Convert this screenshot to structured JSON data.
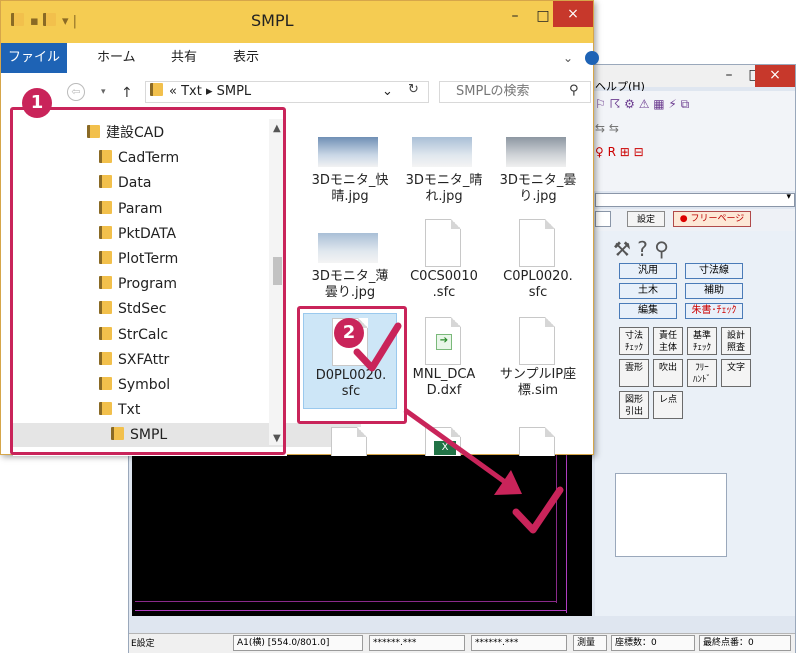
{
  "cad": {
    "menu_help": "ヘルプ(H)",
    "min_glyph": "–",
    "max_glyph": "□",
    "close_glyph": "×",
    "toolbar_row1": "⚐ ☈ ⚙ ⚠ ▦ ⚡ ⧉",
    "toolbar_row2": "⇆ ⇆",
    "toolbar_row3": "♀ R ⊞ ⊟",
    "btn_settei": "設定",
    "btn_freepage": "フリーページ",
    "palette": {
      "hanyou": "汎用",
      "sunposen": "寸法線",
      "doboku": "土木",
      "hojo": "補助",
      "henshu": "編集",
      "shusho_check": "朱書･ﾁｪｯｸ",
      "squares_row1": [
        "寸法\nﾁｪｯｸ",
        "責任\n主体",
        "基準\nﾁｪｯｸ",
        "設計\n照査"
      ],
      "squares_row2": [
        "雲形",
        "吹出",
        "ﾌﾘｰ\nﾊﾝﾄﾞ",
        "文字"
      ],
      "squares_row3": [
        "図形\n引出",
        "レ点"
      ]
    },
    "status": {
      "settings": "E設定",
      "paper": "A1(横) [554.0/801.0]",
      "coord_x": "******.***",
      "coord_y": "******.***",
      "survey": "測量",
      "coord_count": "座標数：0",
      "last_point": "最終点番：0"
    }
  },
  "explorer": {
    "title": "SMPL",
    "min_glyph": "–",
    "max_glyph": "□",
    "close_glyph": "×",
    "ribbon_tabs": [
      "ファイル",
      "ホーム",
      "共有",
      "表示"
    ],
    "ribbon_chevron": "⌄",
    "address": {
      "back": "⇦",
      "fwd": "▾",
      "up": "↑",
      "path": "« Txt ▸ SMPL",
      "dropdown": "⌄",
      "refresh": "↻"
    },
    "search_placeholder": "SMPLの検索",
    "search_glyph": "⚲",
    "nav_items": [
      {
        "label": "建設CAD",
        "indent": 0
      },
      {
        "label": "CadTerm",
        "indent": 1
      },
      {
        "label": "Data",
        "indent": 1
      },
      {
        "label": "Param",
        "indent": 1
      },
      {
        "label": "PktDATA",
        "indent": 1
      },
      {
        "label": "PlotTerm",
        "indent": 1
      },
      {
        "label": "Program",
        "indent": 1
      },
      {
        "label": "StdSec",
        "indent": 1
      },
      {
        "label": "StrCalc",
        "indent": 1
      },
      {
        "label": "SXFAttr",
        "indent": 1
      },
      {
        "label": "Symbol",
        "indent": 1
      },
      {
        "label": "Txt",
        "indent": 1
      },
      {
        "label": "SMPL",
        "indent": 2,
        "selected": true
      }
    ],
    "files": [
      {
        "name": "3Dモニタ_快\n晴.jpg",
        "kind": "img"
      },
      {
        "name": "3Dモニタ_晴\nれ.jpg",
        "kind": "img-cloud"
      },
      {
        "name": "3Dモニタ_曇\nり.jpg",
        "kind": "img-gray"
      },
      {
        "name": "3Dモニタ_薄\n曇り.jpg",
        "kind": "img-cloud"
      },
      {
        "name": "C0CS0010\n.sfc",
        "kind": "doc"
      },
      {
        "name": "C0PL0020.\nsfc",
        "kind": "doc"
      },
      {
        "name": "D0PL0020.\nsfc",
        "kind": "doc",
        "selected": true
      },
      {
        "name": "MNL_DCA\nD.dxf",
        "kind": "dxf"
      },
      {
        "name": "サンプルIP座\n標.sim",
        "kind": "doc"
      }
    ],
    "excel_letter": "X"
  },
  "annotations": {
    "badge1": "1",
    "badge2": "2",
    "accent": "#c9245a"
  }
}
